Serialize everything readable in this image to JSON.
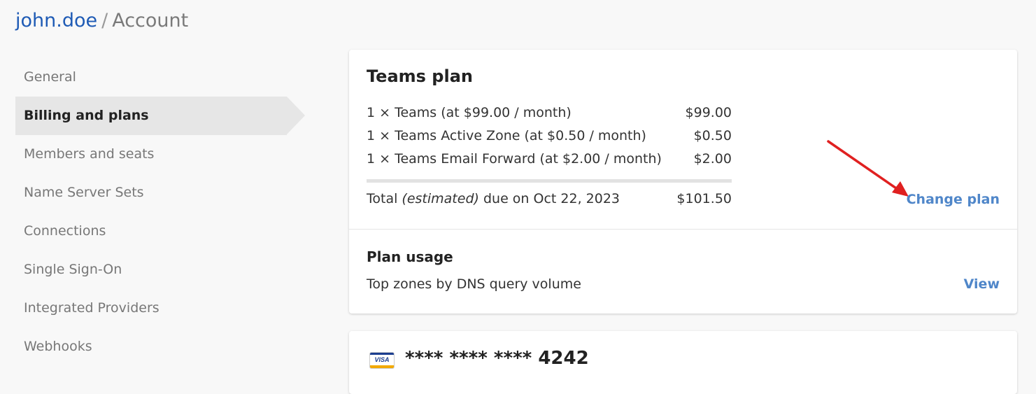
{
  "breadcrumb": {
    "user": "john.doe",
    "separator": "/",
    "page": "Account"
  },
  "sidebar": {
    "items": [
      {
        "label": "General"
      },
      {
        "label": "Billing and plans"
      },
      {
        "label": "Members and seats"
      },
      {
        "label": "Name Server Sets"
      },
      {
        "label": "Connections"
      },
      {
        "label": "Single Sign-On"
      },
      {
        "label": "Integrated Providers"
      },
      {
        "label": "Webhooks"
      }
    ],
    "active": "Billing and plans"
  },
  "plan": {
    "title": "Teams plan",
    "items": [
      {
        "desc": "1 × Teams (at $99.00 / month)",
        "amount": "$99.00"
      },
      {
        "desc": "1 × Teams Active Zone (at $0.50 / month)",
        "amount": "$0.50"
      },
      {
        "desc": "1 × Teams Email Forward (at $2.00 / month)",
        "amount": "$2.00"
      }
    ],
    "total": {
      "prefix": "Total",
      "qualifier": "(estimated)",
      "suffix": "due on Oct 22, 2023",
      "amount": "$101.50"
    },
    "change_link": "Change plan"
  },
  "usage": {
    "title": "Plan usage",
    "row_label": "Top zones by DNS query volume",
    "view_link": "View"
  },
  "payment": {
    "brand_icon": "visa-icon",
    "brand_text": "VISA",
    "masked_number": "**** **** **** 4242"
  },
  "colors": {
    "accent": "#4f86c9",
    "breadcrumb_link": "#1f5bb5",
    "annotation_arrow": "#e02020"
  }
}
